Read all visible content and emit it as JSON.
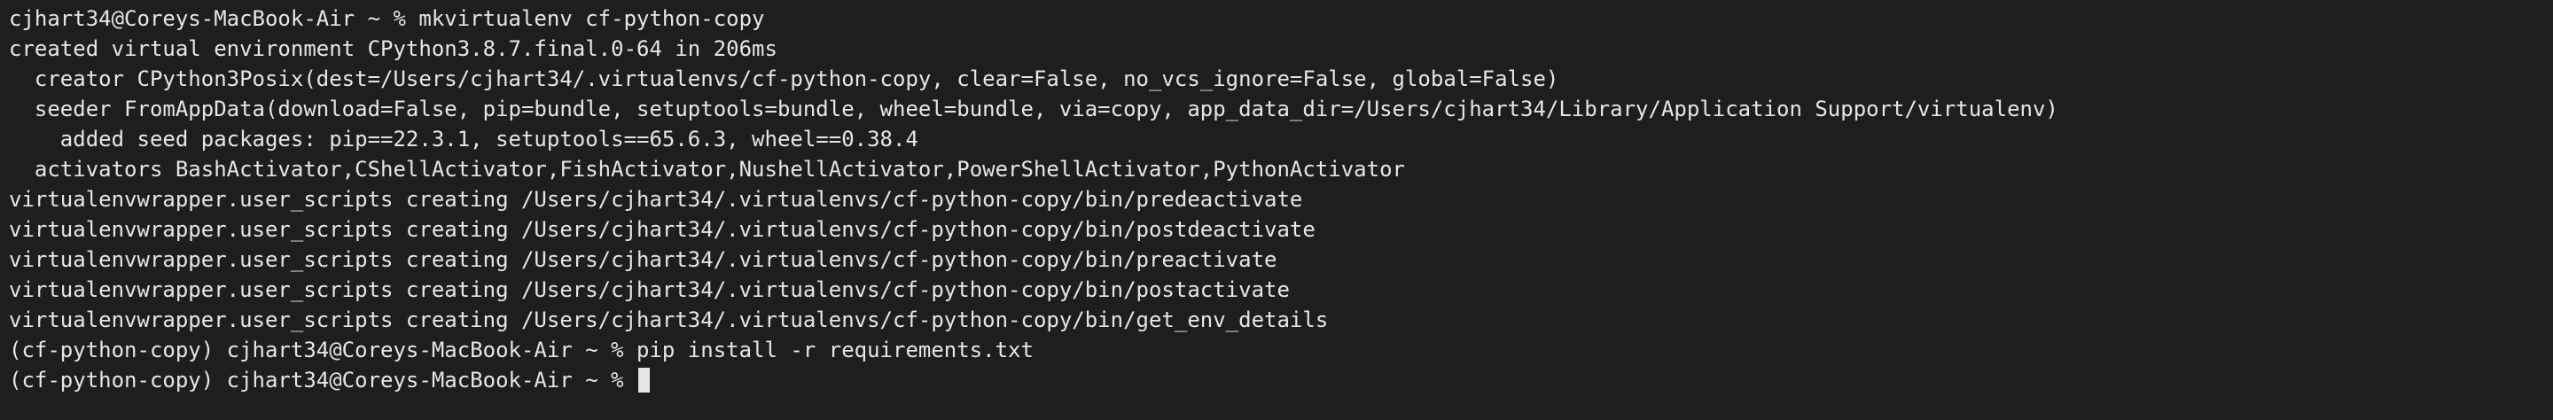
{
  "terminal": {
    "lines": [
      "cjhart34@Coreys-MacBook-Air ~ % mkvirtualenv cf-python-copy",
      "created virtual environment CPython3.8.7.final.0-64 in 206ms",
      "  creator CPython3Posix(dest=/Users/cjhart34/.virtualenvs/cf-python-copy, clear=False, no_vcs_ignore=False, global=False)",
      "  seeder FromAppData(download=False, pip=bundle, setuptools=bundle, wheel=bundle, via=copy, app_data_dir=/Users/cjhart34/Library/Application Support/virtualenv)",
      "    added seed packages: pip==22.3.1, setuptools==65.6.3, wheel==0.38.4",
      "  activators BashActivator,CShellActivator,FishActivator,NushellActivator,PowerShellActivator,PythonActivator",
      "virtualenvwrapper.user_scripts creating /Users/cjhart34/.virtualenvs/cf-python-copy/bin/predeactivate",
      "virtualenvwrapper.user_scripts creating /Users/cjhart34/.virtualenvs/cf-python-copy/bin/postdeactivate",
      "virtualenvwrapper.user_scripts creating /Users/cjhart34/.virtualenvs/cf-python-copy/bin/preactivate",
      "virtualenvwrapper.user_scripts creating /Users/cjhart34/.virtualenvs/cf-python-copy/bin/postactivate",
      "virtualenvwrapper.user_scripts creating /Users/cjhart34/.virtualenvs/cf-python-copy/bin/get_env_details",
      "(cf-python-copy) cjhart34@Coreys-MacBook-Air ~ % pip install -r requirements.txt"
    ],
    "prompt": "(cf-python-copy) cjhart34@Coreys-MacBook-Air ~ % "
  },
  "colors": {
    "background": "#1e1e1e",
    "foreground": "#e6e6e6"
  }
}
